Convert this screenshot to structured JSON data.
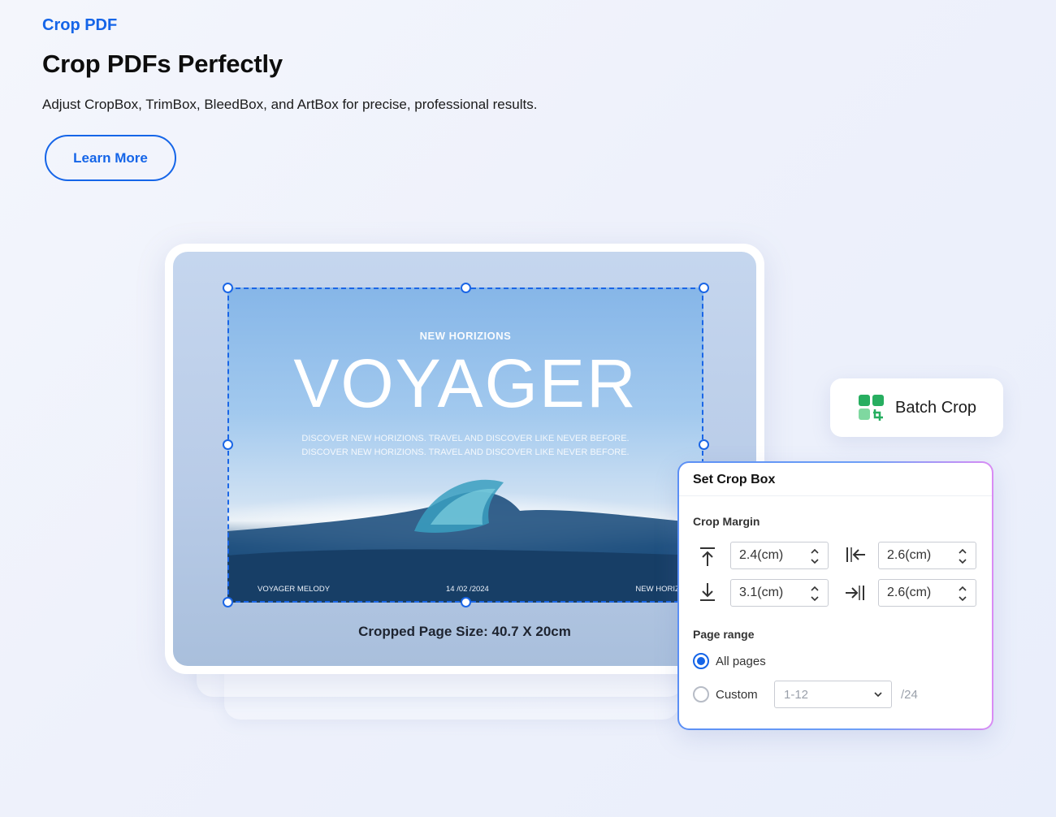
{
  "hero": {
    "eyebrow": "Crop PDF",
    "headline": "Crop PDFs Perfectly",
    "subline": "Adjust CropBox, TrimBox, BleedBox, and ArtBox for precise, professional results.",
    "cta_label": "Learn More"
  },
  "preview": {
    "kicker": "NEW HORIZIONS",
    "title": "VOYAGER",
    "body": "DISCOVER NEW HORIZIONS. TRAVEL AND DISCOVER LIKE NEVER BEFORE. DISCOVER NEW HORIZIONS. TRAVEL AND DISCOVER LIKE NEVER BEFORE.",
    "footer_left": "VOYAGER MELODY",
    "footer_mid": "14 /02 /2024",
    "footer_right": "NEW HORIZIONS",
    "size_label": "Cropped Page Size: 40.7 X 20cm"
  },
  "batch": {
    "label": "Batch Crop"
  },
  "panel": {
    "title": "Set Crop Box",
    "margin_label": "Crop Margin",
    "margins": {
      "top": "2.4(cm)",
      "left": "2.6(cm)",
      "bottom": "3.1(cm)",
      "right": "2.6(cm)"
    },
    "range_label": "Page range",
    "all_pages": "All pages",
    "custom": "Custom",
    "custom_placeholder": "1-12",
    "total_pages": "/24",
    "selected_range": "All pages"
  },
  "colors": {
    "accent": "#1565e8",
    "crop_line": "#1b66e6",
    "batch_green": "#27ae60"
  },
  "icons": [
    "crop-top-icon",
    "crop-left-icon",
    "crop-bottom-icon",
    "crop-right-icon",
    "batch-crop-icon",
    "chevron-down-icon",
    "spinner-icon"
  ]
}
